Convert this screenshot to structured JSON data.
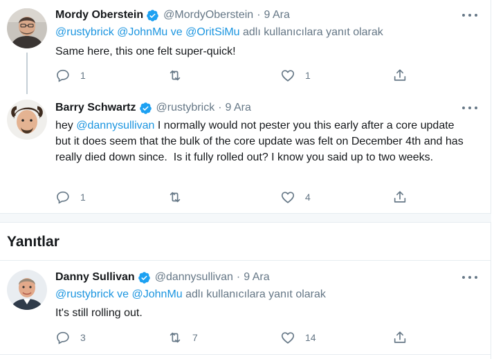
{
  "tweets": [
    {
      "name": "Mordy Oberstein",
      "handle": "@MordyOberstein",
      "dot": "·",
      "time": "9 Ara",
      "replying": {
        "mentions": "@rustybrick @JohnMu ve @OritSiMu",
        "suffix": " adlı kullanıcılara yanıt olarak"
      },
      "text": "Same here, this one felt super-quick!",
      "counts": {
        "reply": "1",
        "retweet": "",
        "like": "1"
      }
    },
    {
      "name": "Barry Schwartz",
      "handle": "@rustybrick",
      "dot": "·",
      "time": "9 Ara",
      "text_parts": {
        "prefix": "hey ",
        "mention": "@dannysullivan",
        "body": " I normally would not pester you this early after a core update but it does seem that the bulk of the core update was felt on December 4th and has really died down since.  Is it fully rolled out? I know you said up to two weeks."
      },
      "counts": {
        "reply": "1",
        "retweet": "",
        "like": "4"
      }
    },
    {
      "name": "Danny Sullivan",
      "handle": "@dannysullivan",
      "dot": "·",
      "time": "9 Ara",
      "replying": {
        "mention1": "@rustybrick",
        "join": " ve ",
        "mention2": "@JohnMu",
        "suffix": " adlı kullanıcılara yanıt olarak"
      },
      "text": "It's still rolling out.",
      "counts": {
        "reply": "3",
        "retweet": "7",
        "like": "14"
      }
    }
  ],
  "replies_section": {
    "title": "Yanıtlar"
  },
  "icons": [
    "reply-icon",
    "retweet-icon",
    "like-icon",
    "share-icon",
    "verified-icon",
    "more-icon"
  ],
  "colors": {
    "link": "#1b95e0",
    "muted": "#657786",
    "verified": "#1da1f2"
  }
}
